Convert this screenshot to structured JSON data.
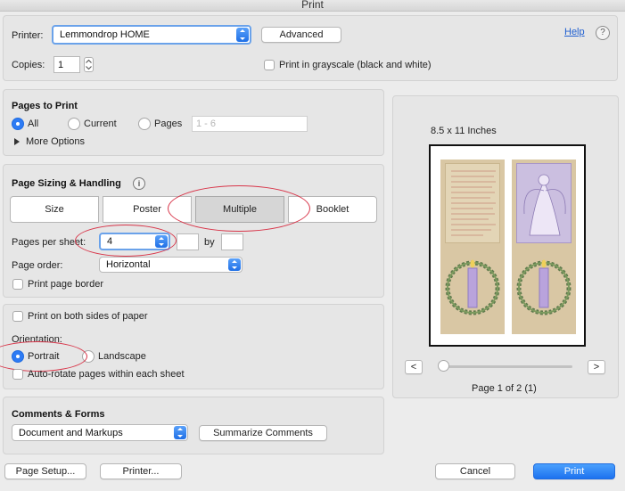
{
  "window": {
    "title": "Print"
  },
  "top": {
    "printer_label": "Printer:",
    "printer_value": "Lemmondrop HOME",
    "advanced_label": "Advanced",
    "help_label": "Help",
    "help_icon_glyph": "?",
    "copies_label": "Copies:",
    "copies_value": "1",
    "grayscale_label": "Print in grayscale (black and white)"
  },
  "pages": {
    "heading": "Pages to Print",
    "all_label": "All",
    "current_label": "Current",
    "pages_label": "Pages",
    "pages_placeholder": "1 - 6",
    "more_options_label": "More Options",
    "selected": "all"
  },
  "sizing": {
    "heading": "Page Sizing & Handling",
    "info_icon_glyph": "i",
    "modes": [
      "Size",
      "Poster",
      "Multiple",
      "Booklet"
    ],
    "selected_mode": "Multiple",
    "pages_per_sheet_label": "Pages per sheet:",
    "pages_per_sheet_value": "4",
    "by_label": "by",
    "page_order_label": "Page order:",
    "page_order_value": "Horizontal",
    "border_label": "Print page border"
  },
  "orientation": {
    "both_sides_label": "Print on both sides of paper",
    "orientation_label": "Orientation:",
    "portrait_label": "Portrait",
    "landscape_label": "Landscape",
    "selected": "Portrait",
    "autorotate_label": "Auto-rotate pages within each sheet"
  },
  "comments": {
    "heading": "Comments & Forms",
    "select_value": "Document and Markups",
    "summarize_label": "Summarize Comments"
  },
  "preview": {
    "paper_size": "8.5 x 11 Inches",
    "prev_label": "<",
    "next_label": ">",
    "page_status": "Page 1 of 2 (1)",
    "slider_position": 0
  },
  "bottom": {
    "page_setup_label": "Page Setup...",
    "printer_label": "Printer...",
    "cancel_label": "Cancel",
    "print_label": "Print"
  },
  "colors": {
    "accent": "#2d7bf4",
    "annotation": "#d8364a"
  }
}
